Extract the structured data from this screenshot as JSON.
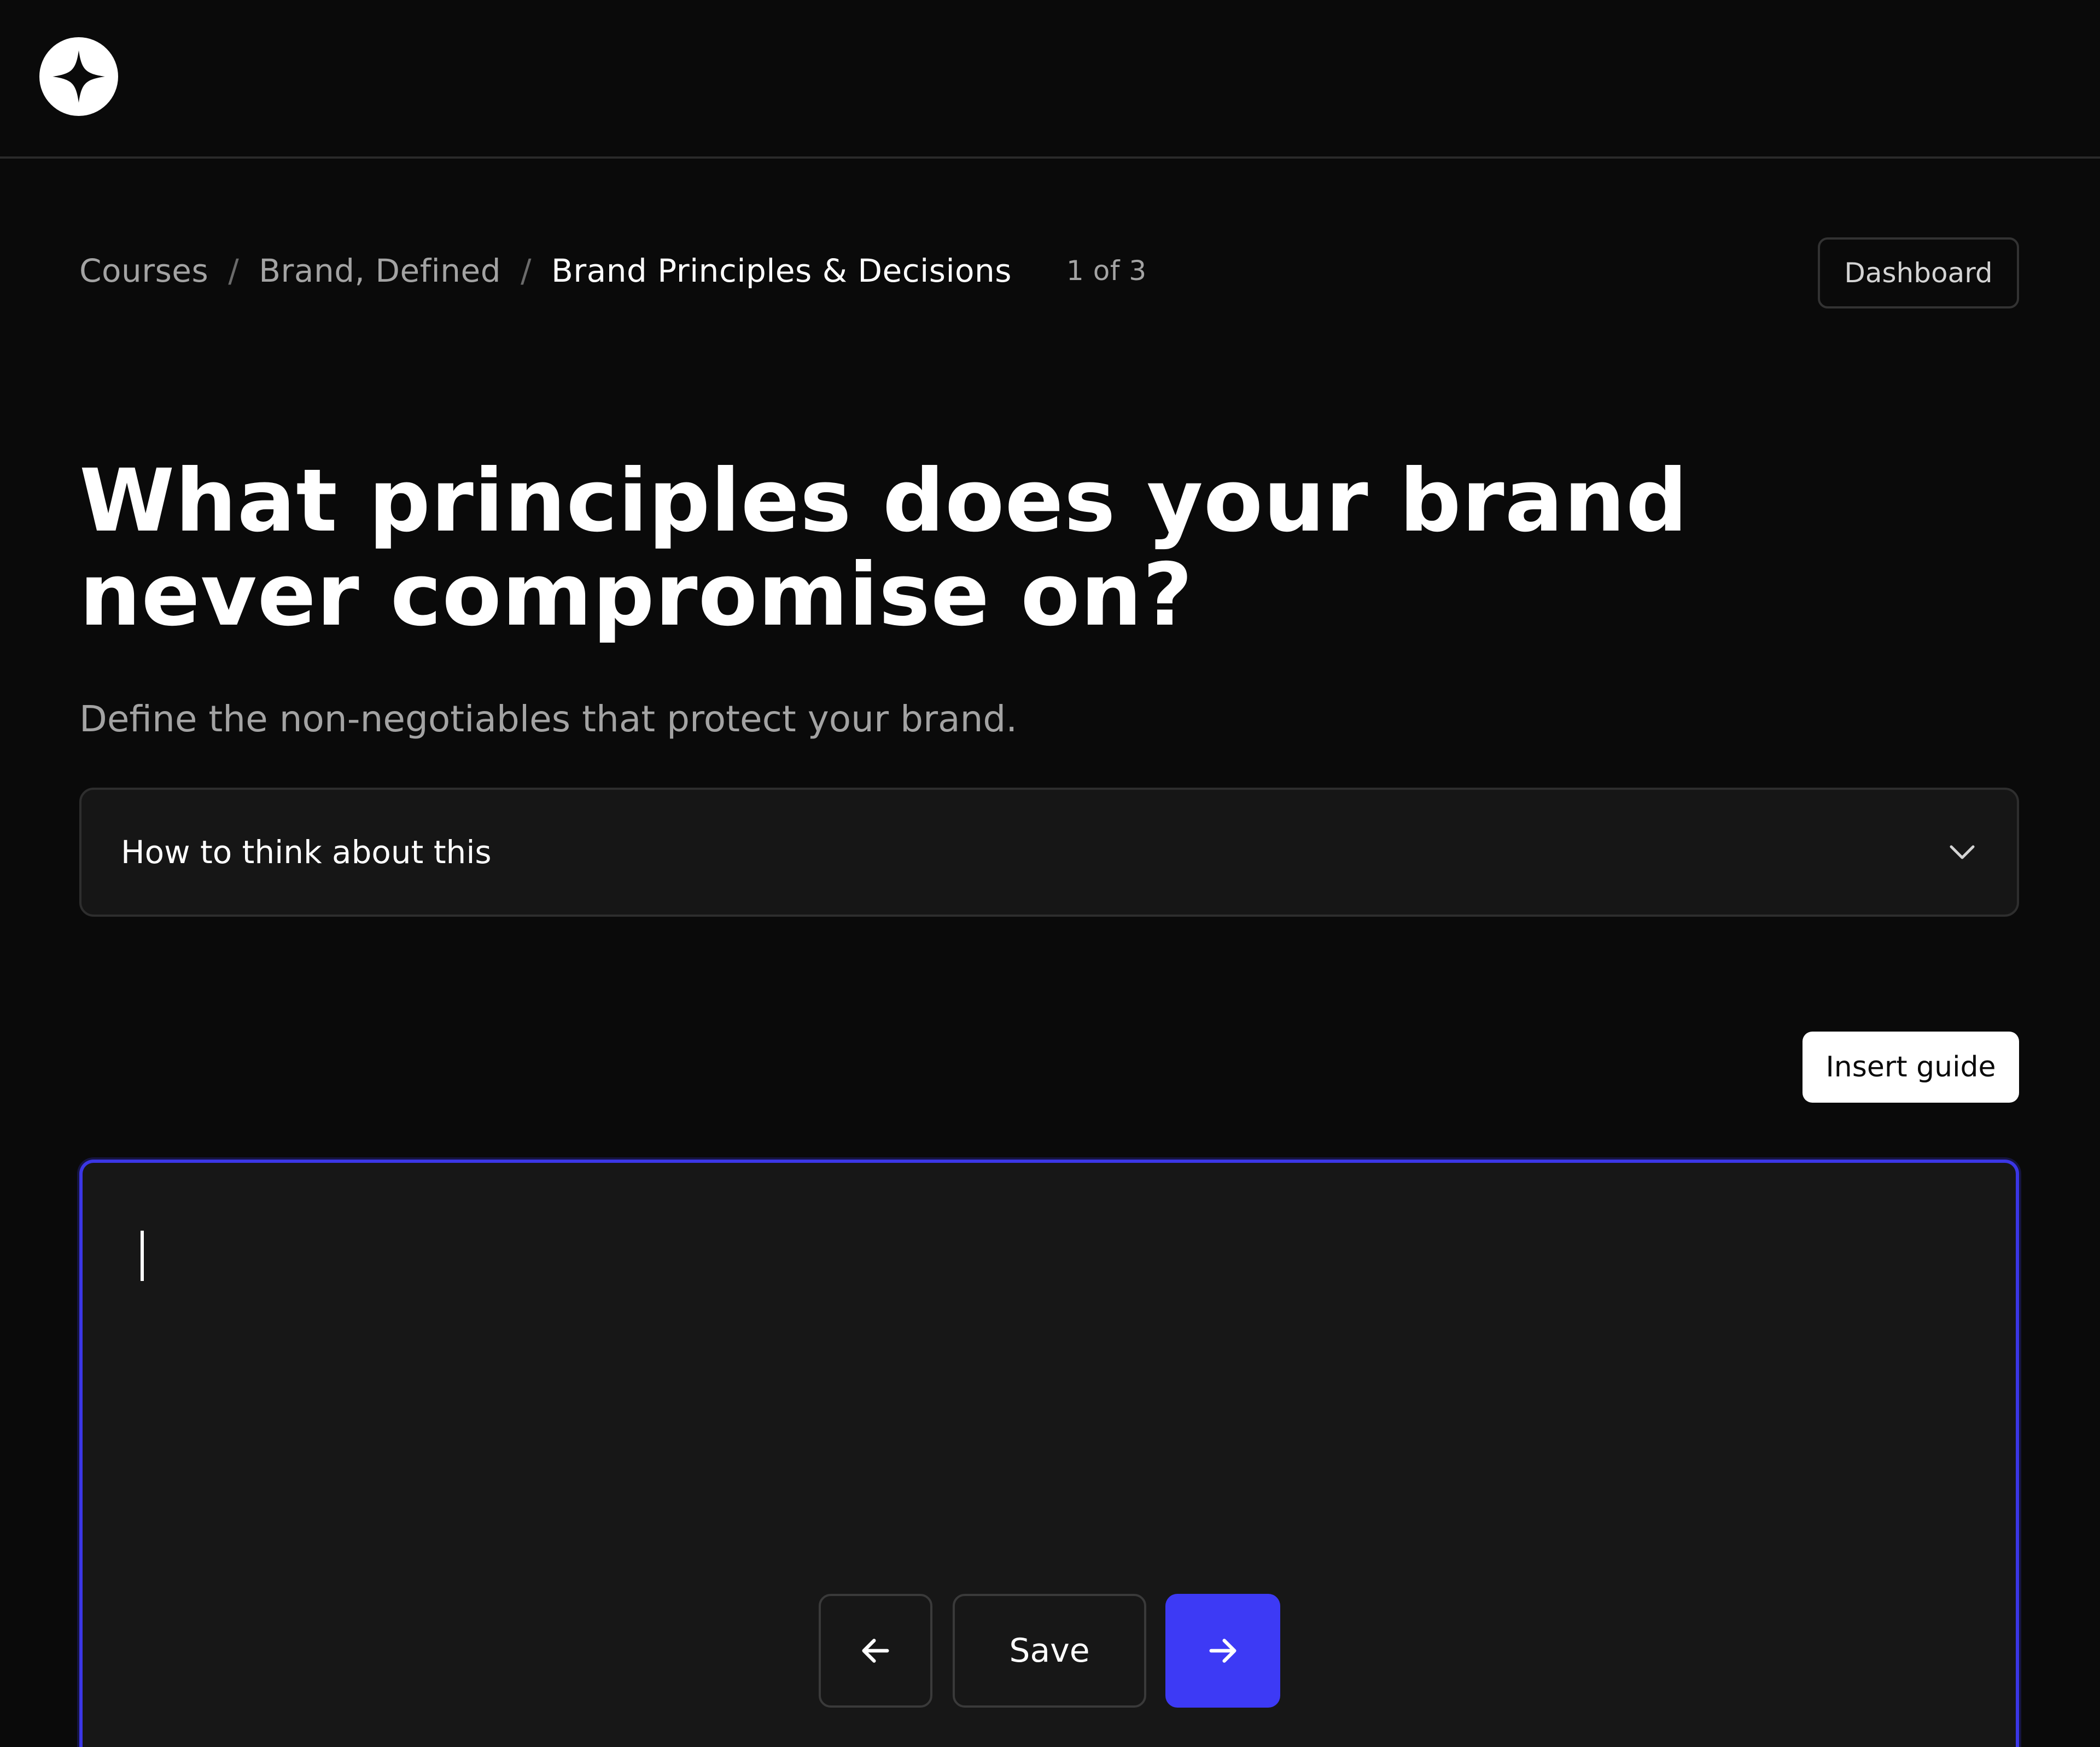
{
  "breadcrumb": {
    "items": [
      "Courses",
      "Brand, Defined",
      "Brand Principles & Decisions"
    ],
    "separator": "/",
    "step": "1 of 3"
  },
  "header": {
    "dashboard_label": "Dashboard",
    "logo_icon": "sparkle-star-icon"
  },
  "main": {
    "title": "What principles does your brand never compromise on?",
    "subtitle": "Define the non-negotiables that protect your brand.",
    "accordion": {
      "label": "How to think about this",
      "icon": "chevron-down-icon"
    },
    "insert_guide_label": "Insert guide",
    "editor": {
      "value": ""
    }
  },
  "controls": {
    "back_icon": "arrow-left-icon",
    "save_label": "Save",
    "next_icon": "arrow-right-icon"
  },
  "colors": {
    "background": "#0a0a0a",
    "surface": "#171717",
    "accent": "#3d3af5",
    "focus_border": "#3b36e6",
    "muted_text": "#a3a3a3"
  }
}
